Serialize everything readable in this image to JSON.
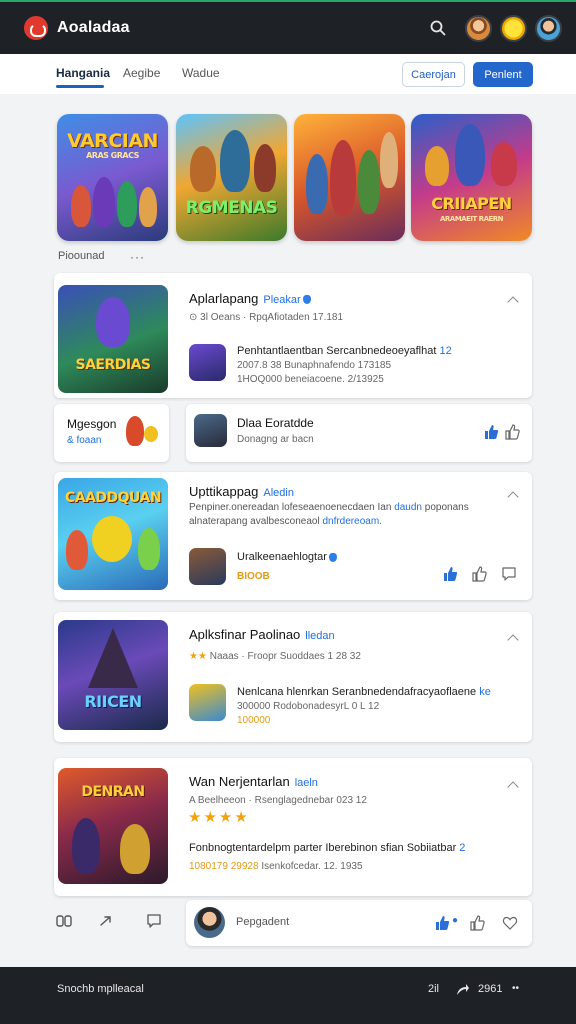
{
  "app": {
    "title": "Aoaladaa",
    "accent": "#2366cc",
    "brand_red": "#e03a2f"
  },
  "topbar": {
    "icons": [
      "search-icon",
      "avatar",
      "avatar",
      "avatar"
    ]
  },
  "tabs": [
    {
      "label": "Hangania",
      "active": true
    },
    {
      "label": "Aegibe",
      "active": false
    },
    {
      "label": "Wadue",
      "active": false
    }
  ],
  "actions": {
    "outline_label": "Caerojan",
    "primary_label": "Penlent"
  },
  "featured": {
    "items": [
      {
        "title": "VARCIAN",
        "sub": "ARAS GRACS"
      },
      {
        "title": "RGMENAS",
        "sub": ""
      },
      {
        "title": "",
        "sub": ""
      },
      {
        "title": "CRIIAPEN",
        "sub": "ARAMAEIT RAERN"
      }
    ],
    "caption": "Pioounad",
    "more": "···"
  },
  "posts": [
    {
      "thumb_title": "SAERDIAS",
      "title": "Aplarlapang",
      "verified": "Pleakar",
      "meta": "3l  Oeans · RpqAfiotaden 17.181",
      "sub_text": "Penhtantlaentban Sercanbnedeoeyaflhat",
      "sub_accent": "12",
      "sub_meta": "2007.8 38 Bunaphnafendo 173185",
      "sub_meta2": "1HOQ000 beneiacoene. 2/13925"
    },
    {
      "thumb_title": "CAADDQUAN",
      "title": "Upttikappag",
      "verified": "Aledin",
      "desc": "Penpiner.onereadan lofeseaenoenecdaen Ian",
      "desc_accent": "daudn",
      "desc_end": "poponans",
      "desc2": "alnaterapang avalbesconeaol",
      "desc2_accent": "dnfrdereoam.",
      "sub_text": "Uralkeenaehlogtar",
      "sub_meta": "BIOOB"
    },
    {
      "thumb_title": "RIICEN",
      "title": "Aplksfinar Paolinao",
      "verified": "lledan",
      "meta": "Naaas · Froopr Suoddaes 1 28 32",
      "sub_text": "Nenlcana hlenrkan Seranbnedendafracyaoflaene",
      "sub_accent": "ke",
      "sub_meta": "300000 RodobonadesyrL 0 L 12",
      "sub_meta_prefix": "100000",
      "sub_meta2": "0 L 12"
    },
    {
      "thumb_title": "DENRAN",
      "title": "Wan Nerjentarlan",
      "verified": "laeln",
      "meta": "A Beelheeon · Rsenglagednebar 023 12",
      "stars": "★★★★",
      "sub_text": "Fonbnogtentardelpm parter Iberebinon sfian Sobiiatbar",
      "sub_accent": "2",
      "sub_meta": "1080179 29928",
      "sub_meta2": "Isenkofcedar. 12. 1935"
    }
  ],
  "side_cards": [
    {
      "label": "Mgesgon",
      "sub": "& foaan"
    },
    {
      "label": "Dlaa Eoratdde",
      "sub": "Donagng ar bacn"
    }
  ],
  "comment": {
    "placeholder": "Pepgadent"
  },
  "bottom": {
    "left": "Snochb mplleacal",
    "n1": "2il",
    "n2": "2961",
    "dots": "••"
  },
  "colors": {
    "topbar": "#1e2227",
    "verified": "#1f6fe0",
    "star": "#f2a20c"
  }
}
